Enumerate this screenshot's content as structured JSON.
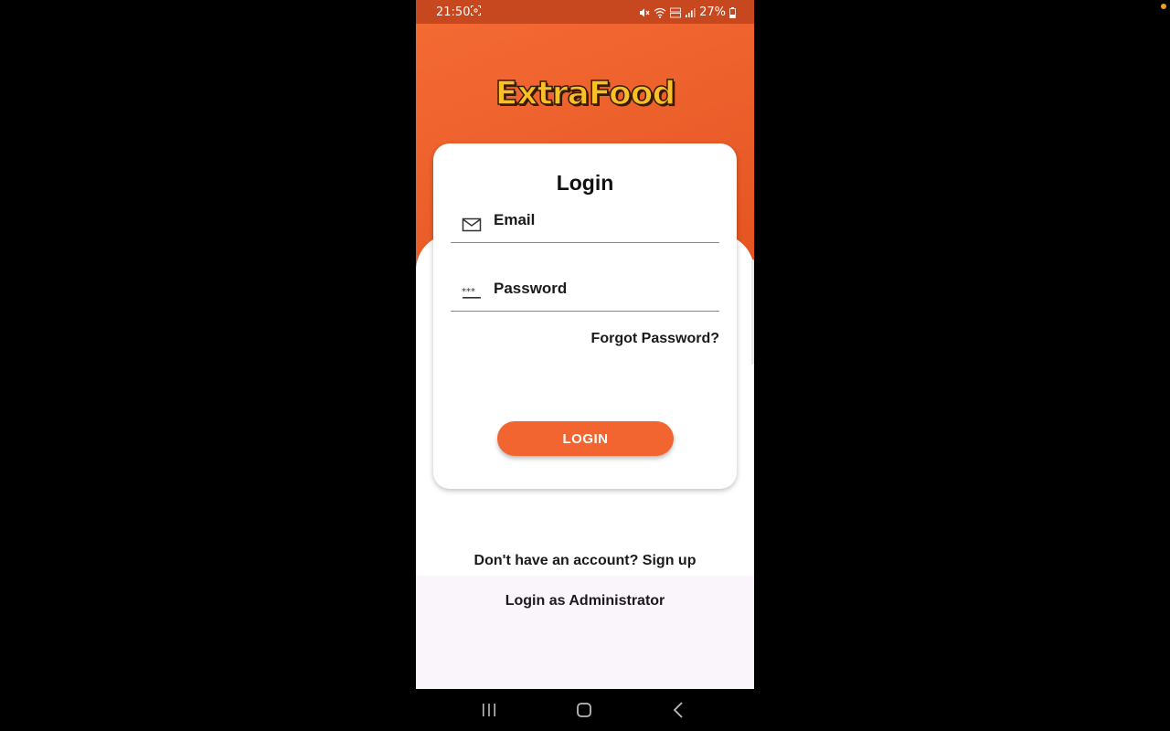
{
  "status_bar": {
    "time": "21:50",
    "battery": "27%",
    "icons": [
      "screen-capture-icon",
      "mute-icon",
      "wifi-icon",
      "lte-icon",
      "signal-icon",
      "battery-icon"
    ]
  },
  "app": {
    "logo_text": "ExtraFood",
    "accent_color": "#f26430",
    "header_color": "#ea5d2a"
  },
  "login_card": {
    "title": "Login",
    "email": {
      "placeholder": "Email",
      "value": "",
      "icon": "mail-icon"
    },
    "password": {
      "placeholder": "Password",
      "value": "",
      "icon": "password-dots-icon"
    },
    "forgot_password": "Forgot Password?",
    "login_button": "LOGIN"
  },
  "footer": {
    "signup_text": "Don't have an account? Sign up",
    "admin_text": "Login as Administrator"
  },
  "nav_bar": {
    "buttons": [
      "recent-apps-icon",
      "home-icon",
      "back-icon"
    ]
  }
}
